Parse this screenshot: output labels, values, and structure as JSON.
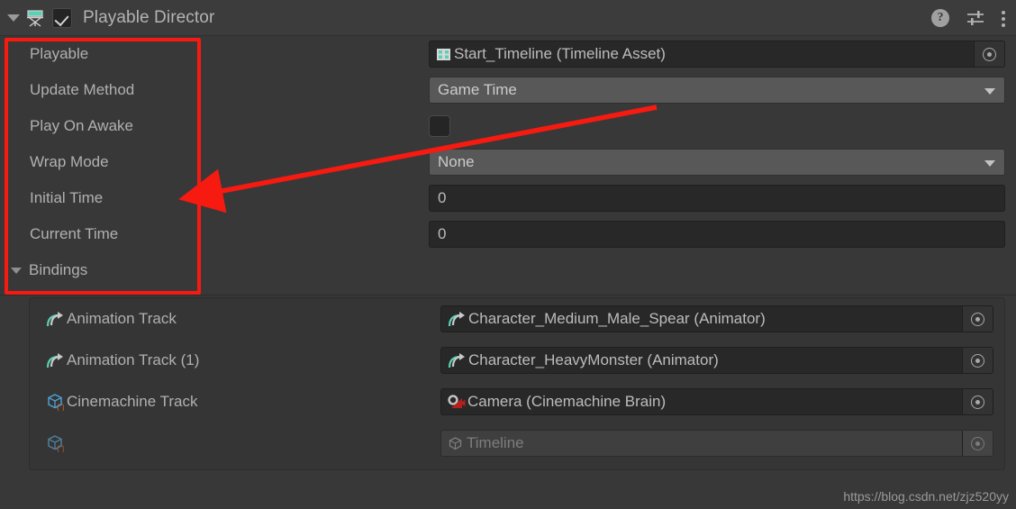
{
  "header": {
    "foldout_icon": "triangle-down-icon",
    "component_icon": "playable-director-icon",
    "enabled_checkbox": true,
    "title": "Playable Director",
    "help_icon": "?",
    "preset_icon": "preset-sliders-icon",
    "menu_icon": "kebab-menu-icon"
  },
  "properties": [
    {
      "label": "Playable",
      "type": "object",
      "icon": "timeline-asset-icon",
      "value": "Start_Timeline (Timeline Asset)"
    },
    {
      "label": "Update Method",
      "type": "dropdown",
      "value": "Game Time"
    },
    {
      "label": "Play On Awake",
      "type": "checkbox",
      "value": false
    },
    {
      "label": "Wrap Mode",
      "type": "dropdown",
      "value": "None"
    },
    {
      "label": "Initial Time",
      "type": "number",
      "value": "0"
    },
    {
      "label": "Current Time",
      "type": "number",
      "value": "0"
    }
  ],
  "bindings_section": {
    "label": "Bindings",
    "expanded": true,
    "rows": [
      {
        "track_icon": "animation-track-icon",
        "track_label": "Animation Track",
        "value_icon": "animator-icon",
        "value": "Character_Medium_Male_Spear (Animator)",
        "muted": false
      },
      {
        "track_icon": "animation-track-icon",
        "track_label": "Animation Track (1)",
        "value_icon": "animator-icon",
        "value": "Character_HeavyMonster (Animator)",
        "muted": false
      },
      {
        "track_icon": "cinemachine-track-icon",
        "track_label": "Cinemachine Track",
        "value_icon": "cinemachine-brain-icon",
        "value": "Camera (Cinemachine Brain)",
        "muted": false
      },
      {
        "track_icon": "cinemachine-track-icon",
        "track_label": "",
        "value_icon": "gameobject-icon",
        "value": "Timeline",
        "muted": true
      }
    ]
  },
  "annotations": {
    "highlight_color": "#f61a11",
    "arrow_from": "update-method-field",
    "arrow_to": "properties-label-column"
  },
  "watermark": "https://blog.csdn.net/zjz520yy",
  "colors": {
    "window_bg": "#383838",
    "header_bg": "#3c3c3c",
    "field_bg": "#282828",
    "dropdown_bg": "#585858",
    "text": "#b0b0b0",
    "accent_teal": "#5ad0b4",
    "accent_blue": "#4f9fd0",
    "accent_orange": "#d4602f",
    "accent_red": "#b4201c"
  }
}
